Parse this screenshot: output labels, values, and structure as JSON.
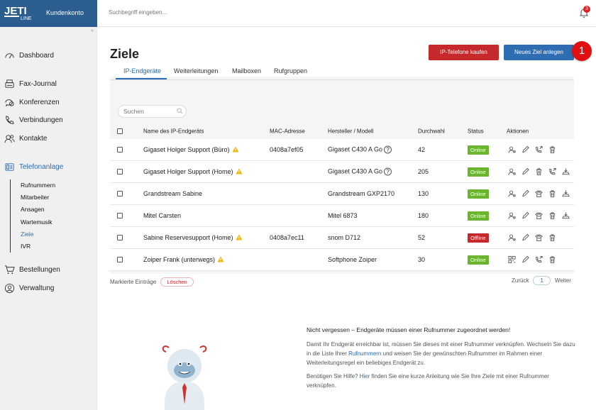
{
  "brand": {
    "logo": "JETI LINE",
    "label": "Kundenkonto",
    "color": "#2b5d8e"
  },
  "topbar": {
    "search_placeholder": "Suchbegriff eingeben...",
    "notifications": "3"
  },
  "sidebar": {
    "items": [
      {
        "label": "Dashboard",
        "icon": "dashboard-icon"
      },
      {
        "label": "Fax-Journal",
        "icon": "fax-icon"
      },
      {
        "label": "Konferenzen",
        "icon": "conference-icon"
      },
      {
        "label": "Verbindungen",
        "icon": "phone-icon"
      },
      {
        "label": "Kontakte",
        "icon": "contacts-icon"
      },
      {
        "label": "Telefonanlage",
        "icon": "phone-system-icon",
        "active": true
      },
      {
        "label": "Bestellungen",
        "icon": "cart-icon"
      },
      {
        "label": "Verwaltung",
        "icon": "user-circle-icon"
      }
    ],
    "subitems": [
      "Rufnummern",
      "Mitarbeiter",
      "Ansagen",
      "Wartemusik",
      "Ziele",
      "IVR"
    ]
  },
  "page": {
    "title": "Ziele",
    "buy_button": "IP-Telefone kaufen",
    "new_button": "Neues Ziel anlegen",
    "marker": "1"
  },
  "tabs": [
    "IP-Endgeräte",
    "Weiterleitungen",
    "Mailboxen",
    "Rufgruppen"
  ],
  "table": {
    "search_placeholder": "Suchen",
    "headers": [
      "Name des IP-Endgeräts",
      "MAC-Adresse",
      "Hersteller / Modell",
      "Durchwahl",
      "Status",
      "Aktionen"
    ],
    "rows": [
      {
        "name": "Gigaset Holger Support (Büro)",
        "warn": true,
        "mac": "0408a7ef05",
        "model": "Gigaset C430 A Go",
        "help": true,
        "ext": "42",
        "status": "Online"
      },
      {
        "name": "Gigaset Holger Support (Home)",
        "warn": true,
        "mac": "",
        "model": "Gigaset C430 A Go",
        "help": true,
        "ext": "205",
        "status": "Online"
      },
      {
        "name": "Grandstream Sabine",
        "warn": false,
        "mac": "",
        "model": "Grandstream GXP2170",
        "help": false,
        "ext": "130",
        "status": "Online"
      },
      {
        "name": "Mitel Carsten",
        "warn": false,
        "mac": "",
        "model": "Mitel 6873",
        "help": false,
        "ext": "180",
        "status": "Online"
      },
      {
        "name": "Sabine Reservesupport (Home)",
        "warn": true,
        "mac": "0408a7ec11",
        "model": "snom D712",
        "help": false,
        "ext": "52",
        "status": "Offline"
      },
      {
        "name": "Zoiper Frank (unterwegs)",
        "warn": true,
        "mac": "",
        "model": "Softphone Zoiper",
        "help": false,
        "ext": "30",
        "status": "Online"
      }
    ]
  },
  "footer": {
    "marked_label": "Markierte Einträge",
    "delete": "Löschen",
    "prev": "Zurück",
    "page": "1",
    "next": "Weiter"
  },
  "info": {
    "heading": "Nicht vergessen – Endgeräte müssen einer Rufnummer zugeordnet werden!",
    "p1a": "Damit Ihr Endgerät erreichbar ist, müssen Sie dieses mit einer Rufnummer verknüpfen. Wechseln Sie dazu in die Liste Ihrer ",
    "p1link": "Rufnummern",
    "p1b": " und weisen Sie der gewünschten Rufnummer im Rahmen einer Weiterleitungsregel ein beliebiges Endgerät zu.",
    "p2a": "Benötigen Sie Hilfe? ",
    "p2link": "Hier",
    "p2b": " finden Sie eine kurze Anleitung wie Sie Ihre Ziele mit einer Rufnummer verknüpfen."
  }
}
